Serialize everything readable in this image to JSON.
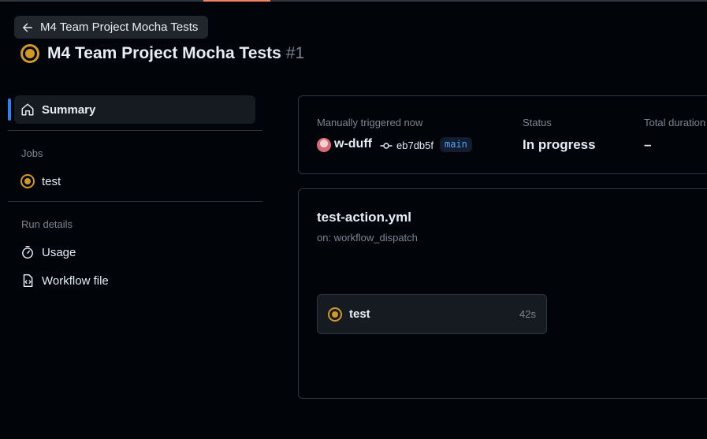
{
  "header": {
    "back_label": "M4 Team Project Mocha Tests",
    "title": "M4 Team Project Mocha Tests",
    "run_number": "#1",
    "status_icon": "in-progress-icon"
  },
  "sidebar": {
    "summary_label": "Summary",
    "jobs_heading": "Jobs",
    "jobs": [
      {
        "label": "test",
        "status": "in-progress"
      }
    ],
    "run_details_heading": "Run details",
    "run_details": [
      {
        "label": "Usage",
        "icon": "stopwatch-icon"
      },
      {
        "label": "Workflow file",
        "icon": "file-code-icon"
      }
    ]
  },
  "summary": {
    "trigger_label": "Manually triggered now",
    "actor": "w-duff",
    "commit_sha": "eb7db5f",
    "branch": "main",
    "status_label": "Status",
    "status_value": "In progress",
    "duration_label": "Total duration",
    "duration_value": "–"
  },
  "graph": {
    "workflow_file": "test-action.yml",
    "trigger": "on: workflow_dispatch",
    "jobs": [
      {
        "name": "test",
        "duration": "42s"
      }
    ]
  },
  "colors": {
    "accent": "#2f81f7",
    "in_progress": "#d29922",
    "branch": "#58a6ff",
    "tab_underline": "#f78166"
  }
}
